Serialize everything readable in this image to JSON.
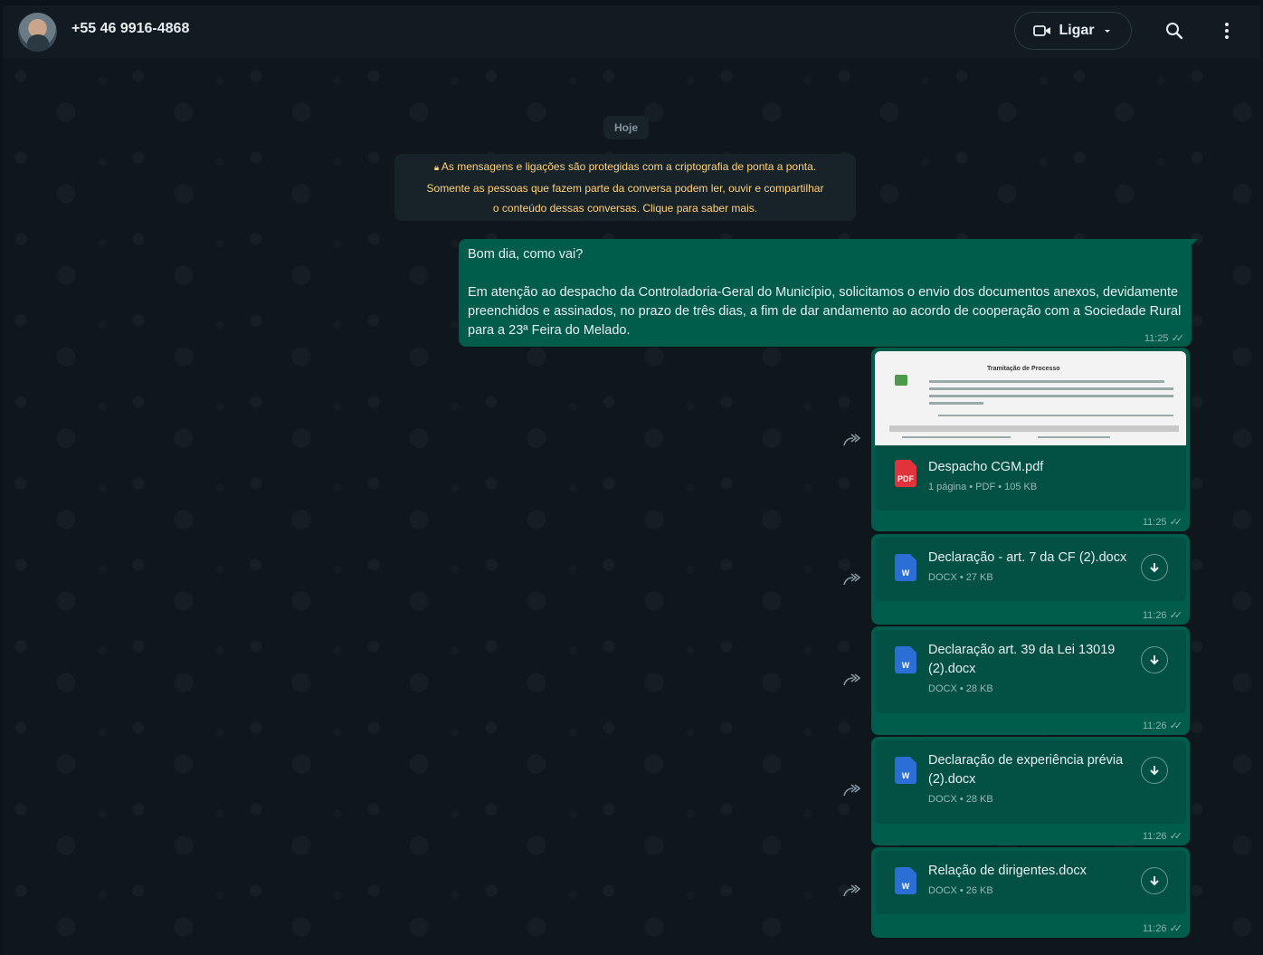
{
  "header": {
    "contact_name": "+55 46 9916-4868",
    "call_label": "Ligar",
    "icons": [
      "video-call-icon",
      "chevron-down-icon",
      "search-icon",
      "menu-icon"
    ]
  },
  "chat": {
    "date_chip": "Hoje",
    "encryption_notice": {
      "line1": "As mensagens e ligações são protegidas com a criptografia de ponta a ponta.",
      "line2": "Somente as pessoas que fazem parte da conversa podem ler, ouvir e compartilhar",
      "line3": "o conteúdo dessas conversas. Clique para saber mais."
    },
    "messages": [
      {
        "type": "text",
        "text": "Bom dia, como vai?\n\nEm atenção ao despacho da Controladoria-Geral do Município, solicitamos o envio dos documentos anexos, devidamente preenchidos e assinados, no prazo de três dias, a fim de dar andamento ao acordo de cooperação com a Sociedade Rural para a 23ª Feira do Melado.",
        "time": "11:25"
      },
      {
        "type": "document",
        "title": "Despacho CGM.pdf",
        "details": "1 página • PDF • 105 KB",
        "time": "11:25",
        "preview_title": "Tramitação de Processo"
      },
      {
        "type": "document",
        "title": "Declaração - art. 7 da CF (2).docx",
        "details": "DOCX • 27 KB",
        "time": "11:26"
      },
      {
        "type": "document",
        "title": "Declaração art. 39 da Lei 13019 (2).docx",
        "details": "DOCX • 28 KB",
        "time": "11:26"
      },
      {
        "type": "document",
        "title": "Declaração de experiência prévia (2).docx",
        "details": "DOCX • 28 KB",
        "time": "11:26"
      },
      {
        "type": "document",
        "title": "Relação de dirigentes.docx",
        "details": "DOCX • 26 KB",
        "time": "11:26"
      }
    ]
  },
  "colors": {
    "outgoing_bubble": "#005c4b",
    "panel": "#111b21",
    "notice_text": "#ffd279",
    "pdf_icon": "#e0333c",
    "word_icon": "#2b6fd6"
  }
}
